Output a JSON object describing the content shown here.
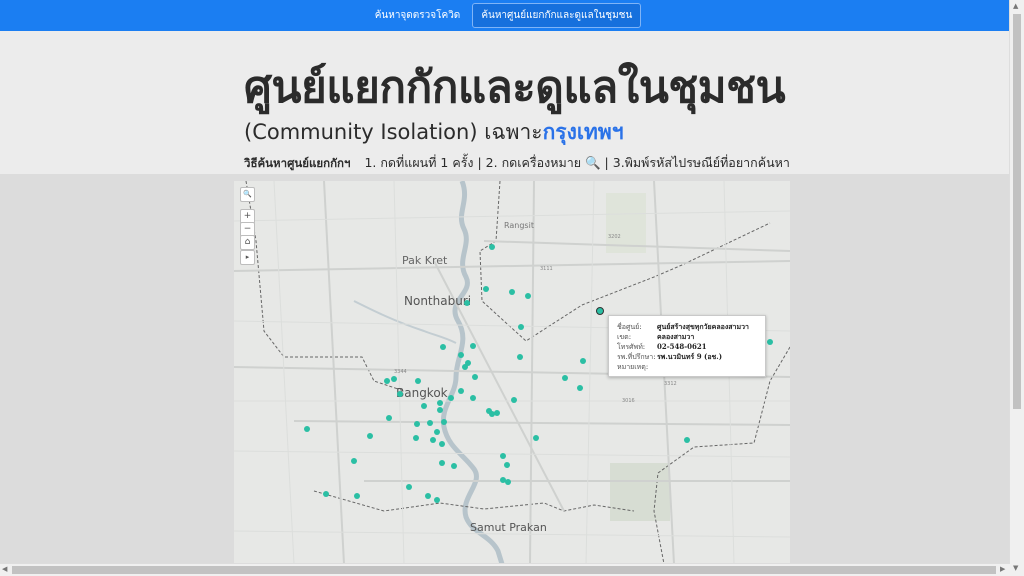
{
  "nav": {
    "items": [
      "ค้นหาจุดตรวจโควิด",
      "ค้นหาศูนย์แยกกักและดูแลในชุมชน"
    ]
  },
  "header": {
    "title": "ศูนย์แยกกักและดูแลในชุมชน",
    "subtitle_prefix": "(Community Isolation) เฉพาะ",
    "subtitle_accent": "กรุงเทพฯ",
    "howto_label": "วิธีค้นหาศูนย์แยกกักฯ",
    "howto_steps": "1. กดที่แผนที่ 1 ครั้ง | 2. กดเครื่องหมาย 🔍 | 3.พิมพ์รหัสไปรษณีย์ที่อยากค้นหา"
  },
  "map": {
    "places": [
      "Rangsit",
      "Pak Kret",
      "Nonthaburi",
      "Bangkok",
      "Samut Prakan"
    ],
    "road_numbers": [
      "3202",
      "3111",
      "3312",
      "305",
      "3344",
      "3016"
    ],
    "controls": [
      "🔍",
      "+",
      "−",
      "⌂",
      "▸"
    ],
    "marker_color": "#2bbfa4",
    "tooltip": {
      "rows": [
        {
          "key": "ชื่อศูนย์:",
          "value": "ศูนย์สร้างสุขทุกวัยคลองสามวา"
        },
        {
          "key": "เขต:",
          "value": "คลองสามวา"
        },
        {
          "key": "โทรศัพท์:",
          "value": "02-548-0621"
        },
        {
          "key": "รพ.ที่ปรึกษา:",
          "value": "รพ.นวมินทร์ 9 (อช.)"
        },
        {
          "key": "หมายเหตุ:",
          "value": ""
        }
      ]
    }
  },
  "scroll": {
    "up": "▲",
    "down": "▼",
    "left": "◀",
    "right": "▶"
  }
}
